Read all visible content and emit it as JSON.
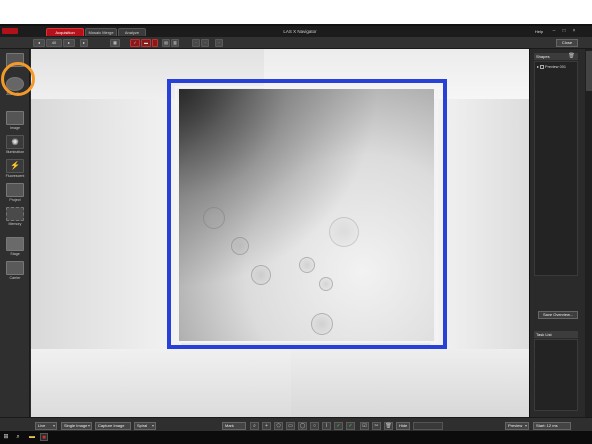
{
  "window": {
    "title": "LAS X Navigator",
    "help_label": "Help",
    "close_label": "Close",
    "minimize": "–",
    "maximize": "□",
    "exit": "×"
  },
  "tabs": [
    {
      "label": "Acquisition",
      "active": true
    },
    {
      "label": "Mosaic Merge",
      "active": false
    },
    {
      "label": "Analyze",
      "active": false
    }
  ],
  "toolbar": {
    "zoom_value": "40",
    "accent_color": "#b3121c"
  },
  "sidebar": {
    "items": [
      {
        "label": "",
        "icon": "overview-icon"
      },
      {
        "label": "Zoom Path",
        "icon": "zoom-path-icon"
      },
      {
        "label": "Image",
        "icon": "camera-icon"
      },
      {
        "label": "Illumination",
        "icon": "illumination-icon"
      },
      {
        "label": "Fluorescent",
        "icon": "fluorescent-icon"
      },
      {
        "label": "Project",
        "icon": "project-icon"
      },
      {
        "label": "Memory",
        "icon": "memory-icon"
      },
      {
        "label": "Stage",
        "icon": "stage-icon"
      },
      {
        "label": "Carrier",
        "icon": "carrier-icon"
      }
    ],
    "highlight_color": "#f39a2b"
  },
  "viewport": {
    "roi_color": "#2741d8"
  },
  "right_panel": {
    "shapes_title": "Shapes",
    "shape_item": "Preview 001",
    "save_overview_label": "Save Overview...",
    "task_list_title": "Task List"
  },
  "bottom_bar": {
    "live_label": "Live",
    "mode_label": "Single Image",
    "capture_label": "Capture Image",
    "spiral_label": "Spiral",
    "mark_label": "Mark",
    "hide_label": "Hide",
    "preview_label": "Preview",
    "start_label": "Start: 12 ms"
  },
  "taskbar": {
    "start_icon": "windows-start-icon",
    "search_icon": "search-icon",
    "folder_icon": "folder-icon",
    "app_icon": "las-x-app-icon"
  }
}
